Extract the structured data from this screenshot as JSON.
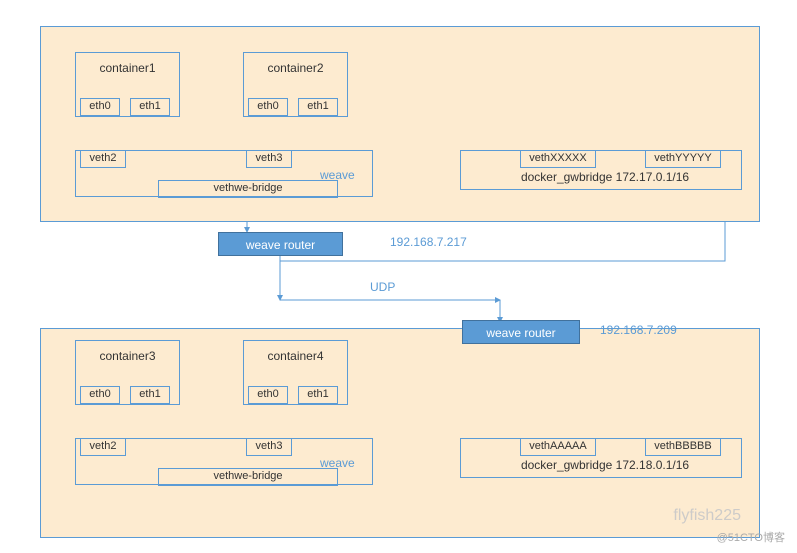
{
  "host1": {
    "container1": {
      "name": "container1",
      "if0": "eth0",
      "if1": "eth1"
    },
    "container2": {
      "name": "container2",
      "if0": "eth0",
      "if1": "eth1"
    },
    "weave": {
      "veth_a": "veth2",
      "veth_b": "veth3",
      "label": "weave",
      "bridge": "vethwe-bridge"
    },
    "gw": {
      "veth_a": "vethXXXXX",
      "veth_b": "vethYYYYY",
      "label": "docker_gwbridge 172.17.0.1/16"
    },
    "router": "weave router",
    "ip": "192.168.7.217"
  },
  "link_proto": "UDP",
  "host2": {
    "container3": {
      "name": "container3",
      "if0": "eth0",
      "if1": "eth1"
    },
    "container4": {
      "name": "container4",
      "if0": "eth0",
      "if1": "eth1"
    },
    "weave": {
      "veth_a": "veth2",
      "veth_b": "veth3",
      "label": "weave",
      "bridge": "vethwe-bridge"
    },
    "gw": {
      "veth_a": "vethAAAAA",
      "veth_b": "vethBBBBB",
      "label": "docker_gwbridge 172.18.0.1/16"
    },
    "router": "weave router",
    "ip": "192.168.7.209"
  },
  "watermark": "flyfish225",
  "sub": "@51CTO博客"
}
